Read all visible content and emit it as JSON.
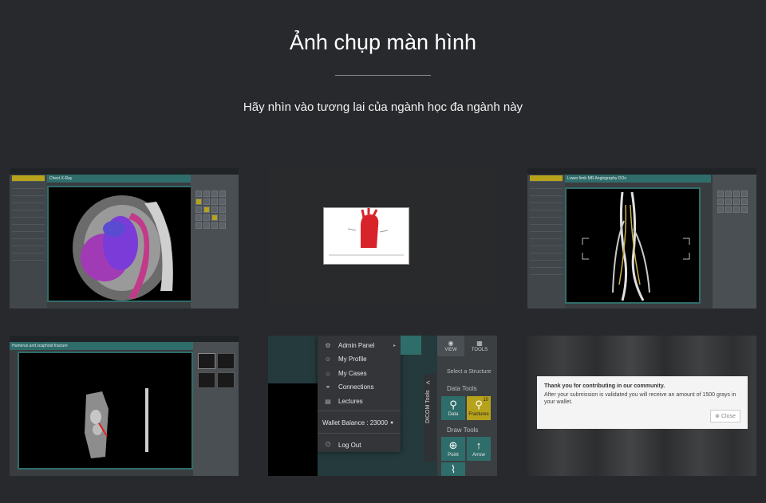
{
  "page": {
    "title": "Ảnh chụp màn hình",
    "subtitle": "Hãy nhìn vào tương lai của ngành học đa ngành này"
  },
  "shot1": {
    "header": "Chest X-Ray",
    "accent": "#b7a21c"
  },
  "shot3": {
    "header": "Lower limb MR Angiography DOs"
  },
  "shot4": {
    "header": "Humerus and scaphoid fracture"
  },
  "shot5": {
    "menu": [
      {
        "icon": "gear-icon",
        "glyph": "⚙",
        "label": "Admin Panel"
      },
      {
        "icon": "user-icon",
        "glyph": "☺",
        "label": "My Profile"
      },
      {
        "icon": "cases-icon",
        "glyph": "⌂",
        "label": "My Cases"
      },
      {
        "icon": "connections-icon",
        "glyph": "⚭",
        "label": "Connections"
      },
      {
        "icon": "lectures-icon",
        "glyph": "▤",
        "label": "Lectures"
      }
    ],
    "wallet_label": "Wallet Balance : 23000",
    "logout_label": "Log Out",
    "vertical_tab": "DICOM Tools",
    "tabs": {
      "view": "VIEW",
      "tools": "TOOLS"
    },
    "select_structure": "Select a Structure",
    "data_tools_heading": "Data Tools",
    "draw_tools_heading": "Draw Tools",
    "data_tools": [
      {
        "label": "Data"
      },
      {
        "label": "Fractures",
        "badge": "10"
      }
    ],
    "draw_tools": [
      {
        "label": "Point"
      },
      {
        "label": "Arrow"
      }
    ]
  },
  "shot6": {
    "dialog_title": "Thank you for contributing in our community.",
    "dialog_body": "After your submission is validated you will receive an amount of 1500 grays in your wallet.",
    "close_label": "Close"
  }
}
